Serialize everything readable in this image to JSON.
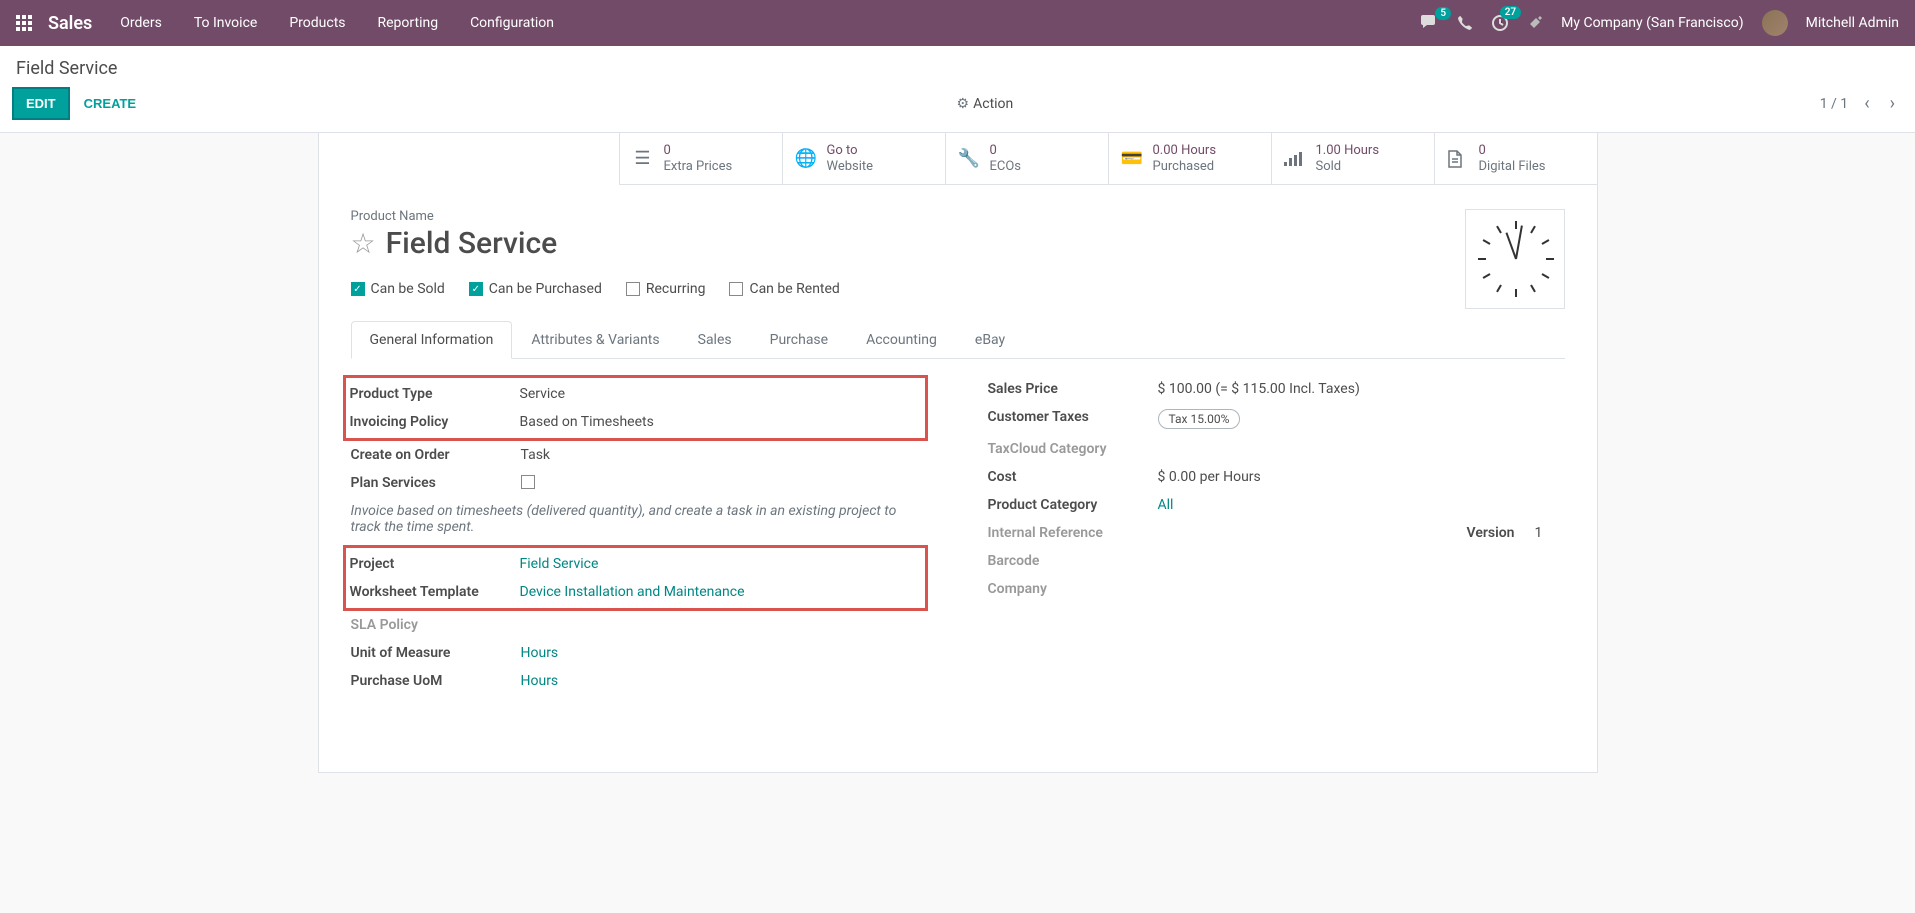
{
  "topbar": {
    "brand": "Sales",
    "nav": [
      "Orders",
      "To Invoice",
      "Products",
      "Reporting",
      "Configuration"
    ],
    "chat_badge": "5",
    "clock_badge": "27",
    "company": "My Company (San Francisco)",
    "user": "Mitchell Admin"
  },
  "breadcrumb": "Field Service",
  "actions": {
    "edit": "EDIT",
    "create": "CREATE",
    "action": "Action",
    "pager": "1 / 1"
  },
  "stats": [
    {
      "value": "0",
      "label": "Extra Prices"
    },
    {
      "value": "Go to",
      "label": "Website"
    },
    {
      "value": "0",
      "label": "ECOs"
    },
    {
      "value": "0.00 Hours",
      "label": "Purchased"
    },
    {
      "value": "1.00 Hours",
      "label": "Sold"
    },
    {
      "value": "0",
      "label": "Digital Files"
    }
  ],
  "product": {
    "name_label": "Product Name",
    "name": "Field Service"
  },
  "checks": {
    "sold": "Can be Sold",
    "purchased": "Can be Purchased",
    "recurring": "Recurring",
    "rented": "Can be Rented"
  },
  "tabs": [
    "General Information",
    "Attributes & Variants",
    "Sales",
    "Purchase",
    "Accounting",
    "eBay"
  ],
  "left": {
    "product_type_label": "Product Type",
    "product_type": "Service",
    "invoicing_policy_label": "Invoicing Policy",
    "invoicing_policy": "Based on Timesheets",
    "create_on_order_label": "Create on Order",
    "create_on_order": "Task",
    "plan_services_label": "Plan Services",
    "help": "Invoice based on timesheets (delivered quantity), and create a task in an existing project to track the time spent.",
    "project_label": "Project",
    "project": "Field Service",
    "worksheet_label": "Worksheet Template",
    "worksheet": "Device Installation and Maintenance",
    "sla_label": "SLA Policy",
    "uom_label": "Unit of Measure",
    "uom": "Hours",
    "puom_label": "Purchase UoM",
    "puom": "Hours"
  },
  "right": {
    "sales_price_label": "Sales Price",
    "sales_price": "$ 100.00  (= $ 115.00 Incl. Taxes)",
    "customer_taxes_label": "Customer Taxes",
    "customer_taxes": "Tax 15.00%",
    "taxcloud_label": "TaxCloud Category",
    "cost_label": "Cost",
    "cost": "$ 0.00  per Hours",
    "product_category_label": "Product Category",
    "product_category": "All",
    "internal_ref_label": "Internal Reference",
    "version_label": "Version",
    "version": "1",
    "barcode_label": "Barcode",
    "company_label": "Company"
  }
}
